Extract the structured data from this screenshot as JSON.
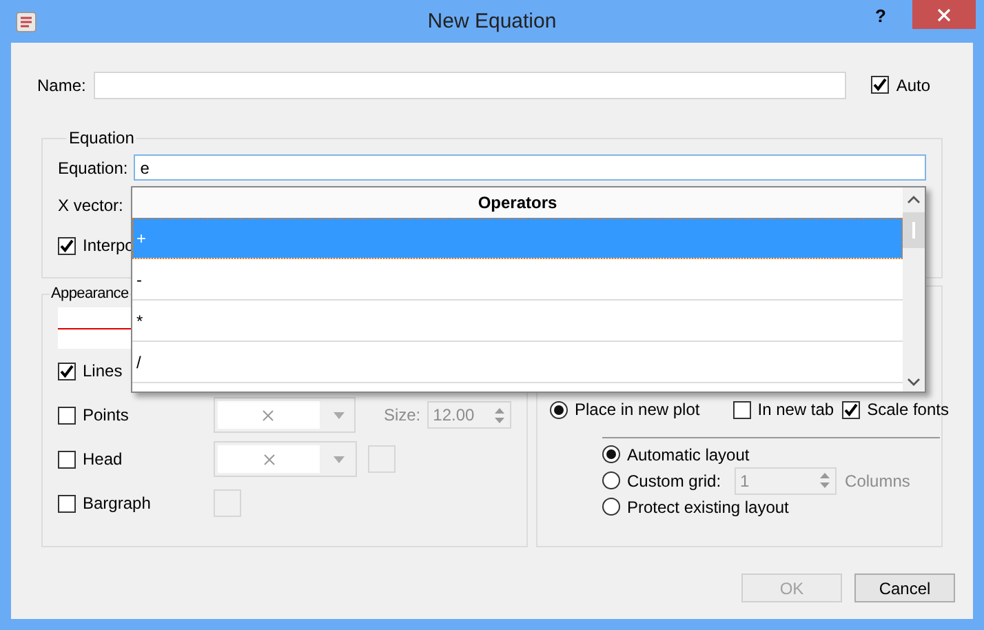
{
  "window": {
    "title": "New Equation",
    "help": "?"
  },
  "name": {
    "label": "Name:"
  },
  "auto": {
    "label": "Auto",
    "checked": true
  },
  "equation_group": {
    "title": "Equation",
    "equation_label": "Equation:",
    "equation_value": "e",
    "x_vector_label": "X vector:",
    "interpolate": {
      "label": "Interpo",
      "checked": true
    }
  },
  "operators_popup": {
    "header": "Operators",
    "items": [
      {
        "label": "+",
        "selected": true
      },
      {
        "label": "-",
        "selected": false
      },
      {
        "label": "*",
        "selected": false
      },
      {
        "label": "/",
        "selected": false
      }
    ]
  },
  "appearance": {
    "title": "Appearance",
    "options": [
      {
        "label": "Lines",
        "checked": true,
        "kind": "line"
      },
      {
        "label": "Points",
        "checked": false,
        "kind": "symbol",
        "size_label": "Size:",
        "size_value": "12.00"
      },
      {
        "label": "Head",
        "checked": false,
        "kind": "symbol_color"
      },
      {
        "label": "Bargraph",
        "checked": false,
        "kind": "color"
      }
    ]
  },
  "placement": {
    "new_plot": {
      "label": "Place in new plot",
      "selected": true
    },
    "new_tab": {
      "label": "In new tab",
      "checked": false
    },
    "scale_fonts": {
      "label": "Scale fonts",
      "checked": true
    },
    "layouts": [
      {
        "label": "Automatic layout",
        "selected": true,
        "kind": "plain"
      },
      {
        "label": "Custom grid:",
        "selected": false,
        "kind": "grid",
        "value": "1",
        "unit": "Columns"
      },
      {
        "label": "Protect existing layout",
        "selected": false,
        "kind": "plain"
      }
    ]
  },
  "buttons": [
    {
      "label": "OK",
      "disabled": true
    },
    {
      "label": "Cancel",
      "disabled": false
    }
  ]
}
